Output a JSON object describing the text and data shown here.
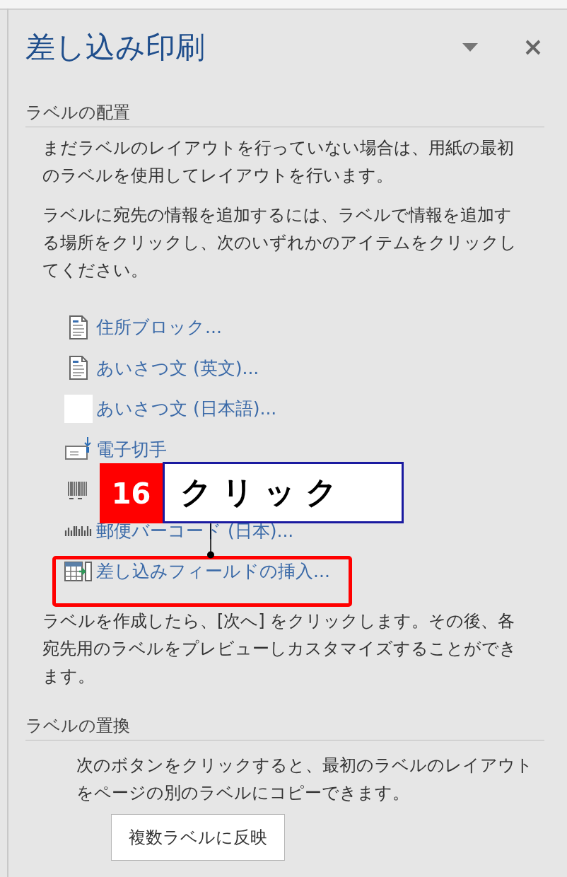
{
  "pane": {
    "title": "差し込み印刷"
  },
  "sections": [
    {
      "heading": "ラベルの配置",
      "paragraphs": [
        "まだラベルのレイアウトを行っていない場合は、用紙の最初のラベルを使用してレイアウトを行います。",
        "ラベルに宛先の情報を追加するには、ラベルで情報を追加する場所をクリックし、次のいずれかのアイテムをクリックしてください。"
      ],
      "items": [
        {
          "kind": "document",
          "label": "住所ブロック...",
          "highlighted": false
        },
        {
          "kind": "document",
          "label": "あいさつ文 (英文)...",
          "highlighted": false
        },
        {
          "kind": "blank",
          "label": "あいさつ文 (日本語)...",
          "highlighted": false
        },
        {
          "kind": "stamp",
          "label": "電子切手",
          "highlighted": false
        },
        {
          "kind": "barcode",
          "highlighted": false
        },
        {
          "kind": "postal",
          "label": "郵便バーコード (日本)...",
          "highlighted": false
        },
        {
          "kind": "table",
          "label": "差し込みフィールドの挿入...",
          "highlighted": true
        }
      ],
      "notes": [
        "ラベルを作成したら、[次へ] をクリックします。その後、各宛先用のラベルをプレビューしカスタマイズすることができます。"
      ]
    },
    {
      "heading": "ラベルの置換",
      "paragraphs": [
        "次のボタンをクリックすると、最初のラベルのレイアウトをページの別のラベルにコピーできます。"
      ],
      "button": "複数ラベルに反映"
    }
  ],
  "callout": {
    "number": "16",
    "text": "クリック"
  }
}
